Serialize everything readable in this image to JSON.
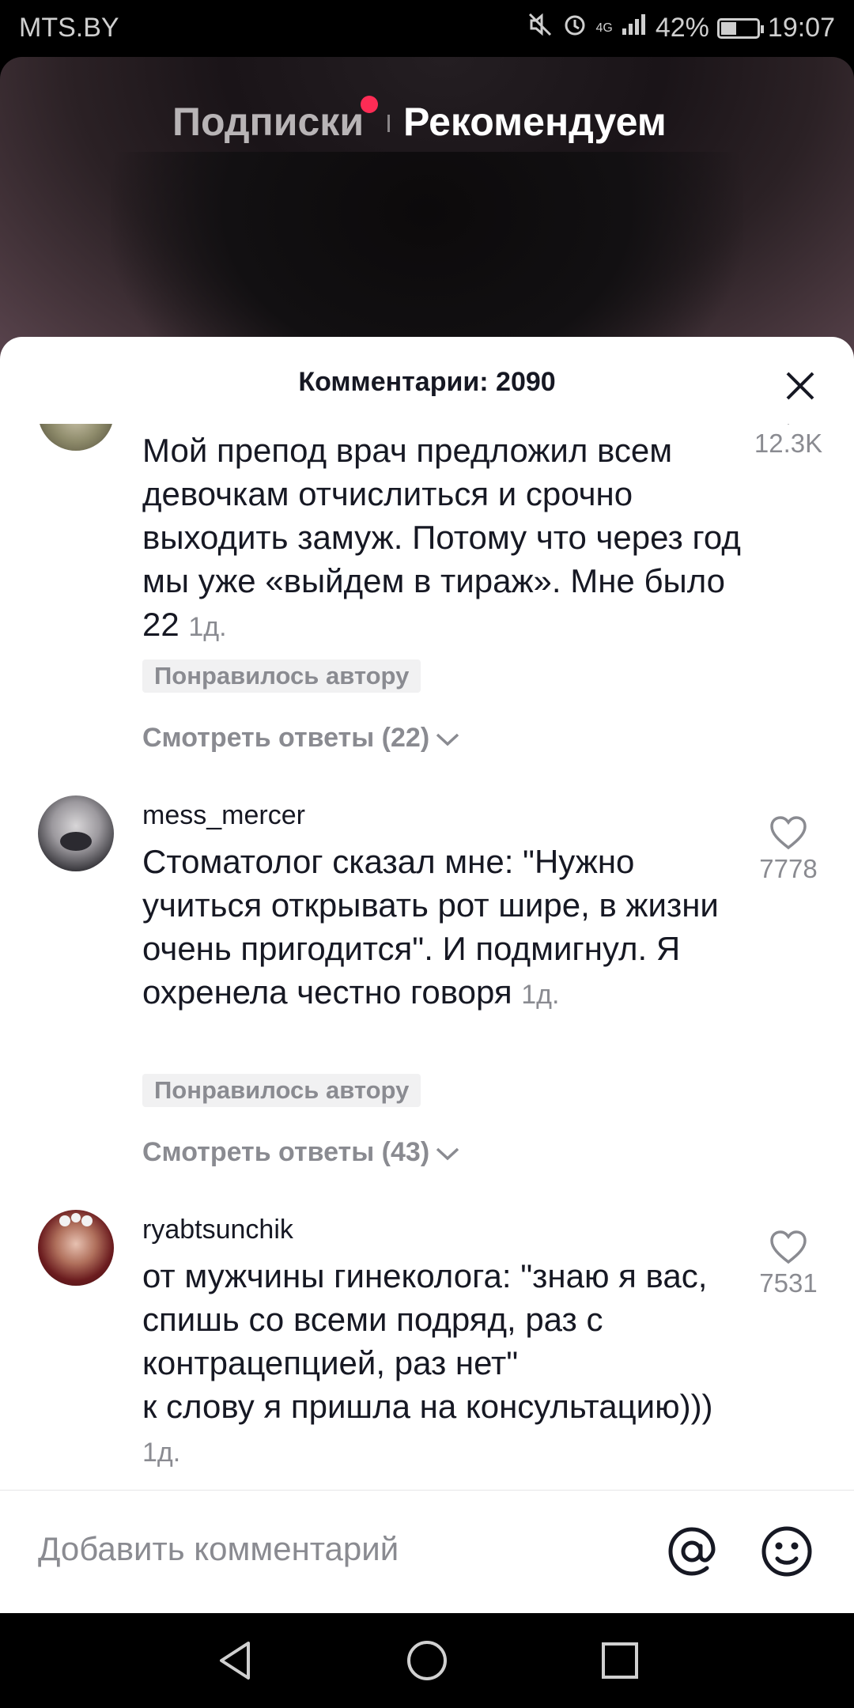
{
  "status_bar": {
    "carrier": "MTS.BY",
    "battery": "42%",
    "time": "19:07",
    "network": "4G",
    "icons": [
      "mute-icon",
      "alarm-icon",
      "signal-icon",
      "battery-icon"
    ]
  },
  "feed_tabs": {
    "following": "Подписки",
    "for_you": "Рекомендуем"
  },
  "comments_sheet": {
    "title": "Комментарии: 2090",
    "comments": [
      {
        "username": "",
        "text": "Мой препод врач предложил всем девочкам отчислиться и срочно выходить замуж. Потому что через год мы уже «выйдем в тираж». Мне было 22",
        "time": "1д.",
        "badge": "Понравилось автору",
        "replies": "Смотреть ответы (22)",
        "likes": "12.3K"
      },
      {
        "username": "mess_mercer",
        "text": "Стоматолог сказал мне: \"Нужно учиться открывать рот шире, в жизни очень пригодится\". И подмигнул. Я охренела честно говоря",
        "time": "1д.",
        "badge": "Понравилось автору",
        "replies": "Смотреть ответы (43)",
        "likes": "7778"
      },
      {
        "username": "ryabtsunchik",
        "text_line1": "от мужчины гинеколога: \"знаю я вас, спишь со всеми подряд, раз с контрацепцией, раз нет\"",
        "text_line2": "к слову я пришла на консультацию)))",
        "time": "1д.",
        "likes": "7531"
      }
    ]
  },
  "input": {
    "placeholder": "Добавить комментарий"
  },
  "colors": {
    "accent": "#fe2c55",
    "text_primary": "#161823",
    "text_secondary": "#8a8b91"
  }
}
